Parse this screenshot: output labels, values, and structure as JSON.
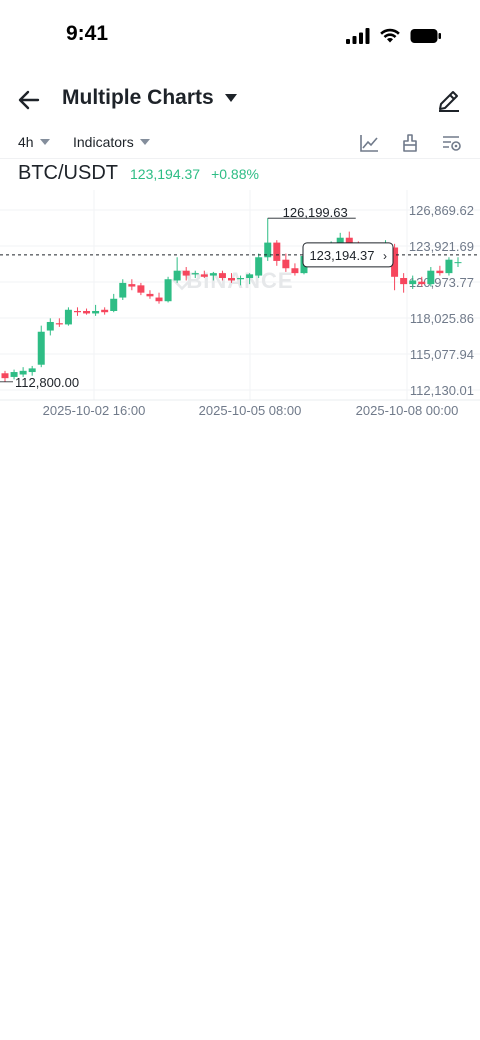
{
  "status": {
    "time": "9:41"
  },
  "header": {
    "title": "Multiple Charts"
  },
  "toolbar": {
    "interval": "4h",
    "indicators": "Indicators"
  },
  "symbol": {
    "pair": "BTC/USDT",
    "price": "123,194.37",
    "change": "+0.88%"
  },
  "colors": {
    "up": "#2ebd85",
    "down": "#f6465d",
    "text": "#1e2329",
    "muted": "#707a8a"
  },
  "icons": [
    "back-arrow-icon",
    "caret-down-icon",
    "edit-pencil-icon",
    "chart-settings-icon",
    "brush-icon",
    "indicator-settings-icon"
  ],
  "chart_data": {
    "type": "candlestick",
    "watermark": "BINANCE",
    "y_ticks": [
      "126,869.62",
      "123,921.69",
      "120,973.77",
      "118,025.86",
      "115,077.94",
      "112,130.01"
    ],
    "x_ticks": [
      "2025-10-02 16:00",
      "2025-10-05 08:00",
      "2025-10-08 00:00"
    ],
    "ylim": [
      112130.01,
      126869.62
    ],
    "high_label": "126,199.63",
    "low_label": "112,800.00",
    "last_price": 123194.37,
    "last_price_label": "123,194.37",
    "candles": [
      [
        113500,
        113700,
        112800,
        113100
      ],
      [
        113200,
        113800,
        113000,
        113600
      ],
      [
        113400,
        114000,
        113200,
        113700
      ],
      [
        113600,
        114100,
        113300,
        113900
      ],
      [
        114200,
        117400,
        114000,
        116900
      ],
      [
        117000,
        118000,
        116600,
        117700
      ],
      [
        117600,
        118000,
        117300,
        117500
      ],
      [
        117500,
        118900,
        117400,
        118700
      ],
      [
        118600,
        118900,
        118200,
        118500
      ],
      [
        118600,
        118800,
        118300,
        118400
      ],
      [
        118400,
        119100,
        118200,
        118600
      ],
      [
        118700,
        118900,
        118300,
        118500
      ],
      [
        118600,
        120000,
        118500,
        119600
      ],
      [
        119700,
        121200,
        119500,
        120900
      ],
      [
        120800,
        121200,
        120300,
        120600
      ],
      [
        120700,
        120900,
        119900,
        120100
      ],
      [
        120000,
        120300,
        119600,
        119800
      ],
      [
        119700,
        120100,
        119200,
        119400
      ],
      [
        119400,
        121400,
        119300,
        121200
      ],
      [
        121100,
        123000,
        120900,
        121900
      ],
      [
        121900,
        122200,
        121100,
        121500
      ],
      [
        121600,
        121900,
        121300,
        121700
      ],
      [
        121600,
        121900,
        121300,
        121400
      ],
      [
        121500,
        121800,
        121100,
        121700
      ],
      [
        121700,
        121900,
        121100,
        121300
      ],
      [
        121300,
        121700,
        120900,
        121100
      ],
      [
        121200,
        121500,
        120700,
        121300
      ],
      [
        121300,
        121700,
        120800,
        121600
      ],
      [
        121500,
        123300,
        121300,
        123000
      ],
      [
        123000,
        126199.63,
        122700,
        124200
      ],
      [
        124200,
        124400,
        122300,
        122700
      ],
      [
        122800,
        123300,
        121800,
        122100
      ],
      [
        122100,
        122500,
        121500,
        121700
      ],
      [
        121700,
        123300,
        121600,
        123100
      ],
      [
        123100,
        123600,
        122700,
        123400
      ],
      [
        123400,
        123700,
        123000,
        123300
      ],
      [
        123300,
        124300,
        123100,
        124100
      ],
      [
        124100,
        125000,
        123900,
        124600
      ],
      [
        124600,
        125100,
        123900,
        124000
      ],
      [
        124000,
        124300,
        123300,
        123500
      ],
      [
        123500,
        123900,
        123100,
        123700
      ],
      [
        123700,
        123900,
        122800,
        123000
      ],
      [
        123100,
        124400,
        122700,
        123900
      ],
      [
        123800,
        124100,
        120300,
        121400
      ],
      [
        121300,
        121700,
        120100,
        120800
      ],
      [
        120800,
        121500,
        120400,
        121100
      ],
      [
        121000,
        121400,
        120600,
        120800
      ],
      [
        120800,
        122200,
        120600,
        121900
      ],
      [
        121900,
        122300,
        121500,
        121700
      ],
      [
        121700,
        123000,
        121500,
        122800
      ],
      [
        122600,
        123000,
        122200,
        122600
      ]
    ]
  }
}
